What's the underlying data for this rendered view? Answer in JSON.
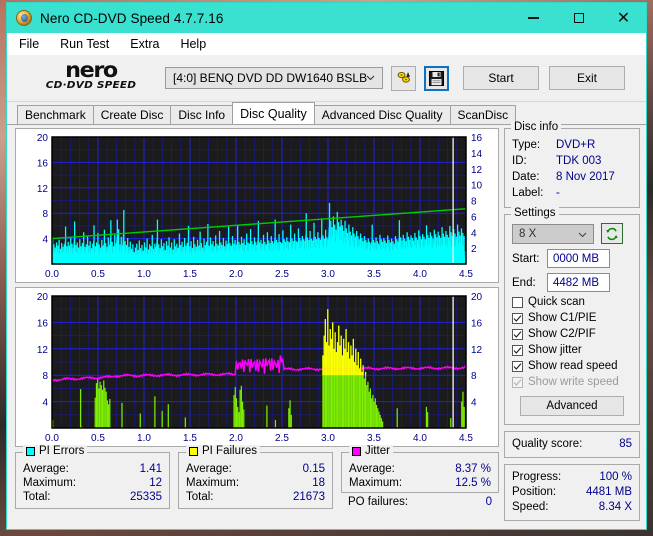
{
  "window": {
    "title": "Nero CD-DVD Speed 4.7.7.16",
    "icon": "nero-disc-icon",
    "accent_titlebar": "#3ae0d0",
    "minimize": "–",
    "maximize": "□",
    "close": "✕"
  },
  "menu": {
    "items": [
      "File",
      "Run Test",
      "Extra",
      "Help"
    ]
  },
  "toolbar": {
    "logo_main": "nero",
    "logo_sub": "CD·DVD  SPEED",
    "drive": "[4:0]   BENQ DVD DD DW1640 BSLB",
    "icon_buttons": [
      "disc-speed-icon",
      "save-floppy-icon"
    ],
    "start_label": "Start",
    "exit_label": "Exit"
  },
  "tabs": {
    "items": [
      "Benchmark",
      "Create Disc",
      "Disc Info",
      "Disc Quality",
      "Advanced Disc Quality",
      "ScanDisc"
    ],
    "active": "Disc Quality"
  },
  "disc_info": {
    "legend": "Disc info",
    "rows": [
      {
        "key": "Type:",
        "value": "DVD+R"
      },
      {
        "key": "ID:",
        "value": "TDK 003"
      },
      {
        "key": "Date:",
        "value": "8 Nov 2017"
      },
      {
        "key": "Label:",
        "value": "-"
      }
    ]
  },
  "settings": {
    "legend": "Settings",
    "speed": "8 X",
    "refresh_icon": "refresh-icon",
    "start_label": "Start:",
    "start_value": "0000 MB",
    "end_label": "End:",
    "end_value": "4482 MB",
    "checkboxes": [
      {
        "label": "Quick scan",
        "checked": false,
        "disabled": false
      },
      {
        "label": "Show C1/PIE",
        "checked": true,
        "disabled": false
      },
      {
        "label": "Show C2/PIF",
        "checked": true,
        "disabled": false
      },
      {
        "label": "Show jitter",
        "checked": true,
        "disabled": false
      },
      {
        "label": "Show read speed",
        "checked": true,
        "disabled": false
      },
      {
        "label": "Show write speed",
        "checked": true,
        "disabled": true
      }
    ],
    "advanced_label": "Advanced"
  },
  "quality": {
    "label": "Quality score:",
    "value": "85"
  },
  "progress": {
    "rows": [
      {
        "key": "Progress:",
        "value": "100 %"
      },
      {
        "key": "Position:",
        "value": "4481 MB"
      },
      {
        "key": "Speed:",
        "value": "8.34 X"
      }
    ]
  },
  "stats": {
    "pi_errors": {
      "title": "PI Errors",
      "color": "#00ffff",
      "rows": [
        {
          "key": "Average:",
          "value": "1.41"
        },
        {
          "key": "Maximum:",
          "value": "12"
        },
        {
          "key": "Total:",
          "value": "25335"
        }
      ]
    },
    "pi_failures": {
      "title": "PI Failures",
      "color": "#ffff00",
      "rows": [
        {
          "key": "Average:",
          "value": "0.15"
        },
        {
          "key": "Maximum:",
          "value": "18"
        },
        {
          "key": "Total:",
          "value": "21673"
        }
      ]
    },
    "jitter": {
      "title": "Jitter",
      "color": "#ff00ff",
      "rows": [
        {
          "key": "Average:",
          "value": "8.37 %"
        },
        {
          "key": "Maximum:",
          "value": "12.5 %"
        }
      ],
      "po_label": "PO failures:",
      "po_value": "0"
    }
  },
  "chart_data": [
    {
      "type": "area",
      "title": "PI Errors / Read speed",
      "xlabel": "",
      "ylabel": "PI Errors",
      "x_ticks": [
        "0.0",
        "0.5",
        "1.0",
        "1.5",
        "2.0",
        "2.5",
        "3.0",
        "3.5",
        "4.0",
        "4.5"
      ],
      "xlim": [
        0,
        4.5
      ],
      "y_left_ticks": [
        4,
        8,
        12,
        16,
        20
      ],
      "ylim": [
        0,
        20
      ],
      "y_right_ticks": [
        2,
        4,
        6,
        8,
        10,
        12,
        14,
        16
      ],
      "y_right_lim": [
        0,
        16
      ],
      "grid": true,
      "background": "#1b1b1b",
      "series": [
        {
          "name": "PI Errors",
          "color": "#00ffff",
          "kind": "area"
        },
        {
          "name": "Read speed",
          "color": "#00cc00",
          "kind": "line"
        }
      ],
      "pi_values": [
        4.2,
        3.1,
        2.6,
        3.4,
        2.9,
        3.8,
        2.4,
        3.3,
        2.7,
        3.1,
        5.9,
        2.8,
        3.5,
        2.9,
        4.1,
        3.2,
        2.5,
        6.7,
        3.0,
        3.4,
        2.6,
        3.9,
        2.8,
        3.3,
        5.0,
        2.7,
        3.1,
        4.4,
        2.9,
        3.6,
        2.5,
        3.2,
        6.1,
        2.8,
        3.4,
        4.9,
        3.1,
        2.6,
        3.8,
        2.9,
        5.4,
        3.3,
        2.7,
        4.2,
        3.0,
        6.9,
        3.5,
        2.8,
        4.6,
        3.2,
        7.0,
        5.5,
        3.1,
        4.3,
        2.9,
        8.5,
        3.6,
        3.0,
        4.1,
        2.7,
        3.5,
        2.4,
        3.1,
        1.9,
        2.6,
        3.2,
        2.2,
        3.7,
        2.5,
        3.0,
        2.1,
        3.4,
        2.6,
        4.0,
        2.3,
        3.1,
        2.8,
        4.6,
        2.4,
        3.2,
        2.7,
        7.0,
        3.1,
        2.5,
        3.9,
        2.8,
        3.3,
        2.2,
        3.6,
        2.9,
        4.2,
        2.6,
        3.4,
        2.3,
        3.9,
        2.8,
        3.2,
        2.5,
        4.8,
        3.0,
        3.5,
        2.7,
        4.1,
        2.9,
        3.3,
        6.0,
        2.8,
        3.6,
        2.5,
        4.3,
        3.1,
        2.7,
        3.8,
        2.9,
        5.1,
        3.3,
        2.6,
        4.0,
        3.0,
        3.5,
        6.3,
        2.9,
        4.2,
        3.1,
        3.6,
        2.8,
        4.5,
        3.2,
        2.9,
        5.2,
        3.4,
        3.0,
        4.1,
        2.8,
        3.7,
        3.1,
        5.9,
        3.3,
        2.9,
        4.4,
        3.2,
        3.8,
        3.0,
        6.0,
        3.5,
        3.1,
        4.3,
        3.3,
        3.9,
        3.0,
        4.8,
        3.4,
        3.2,
        5.5,
        3.6,
        3.1,
        4.2,
        3.5,
        3.0,
        6.8,
        3.4,
        3.8,
        3.2,
        4.6,
        3.5,
        3.1,
        5.0,
        3.7,
        3.3,
        4.4,
        3.6,
        3.2,
        7.0,
        3.8,
        3.4,
        4.7,
        3.5,
        3.3,
        5.3,
        3.9,
        3.5,
        4.2,
        3.6,
        3.4,
        6.2,
        4.0,
        3.6,
        4.8,
        3.7,
        3.5,
        5.6,
        4.1,
        3.7,
        4.4,
        3.9,
        3.6,
        8.0,
        4.2,
        3.8,
        5.2,
        4.0,
        3.7,
        6.5,
        4.3,
        3.9,
        5.0,
        4.1,
        3.8,
        7.2,
        4.5,
        4.0,
        5.4,
        4.2,
        3.9,
        9.6,
        6.8,
        5.8,
        7.5,
        6.2,
        5.4,
        8.2,
        6.6,
        5.9,
        7.0,
        6.1,
        5.2,
        6.8,
        5.6,
        4.9,
        6.2,
        5.1,
        4.5,
        5.8,
        4.8,
        4.3,
        5.2,
        4.4,
        3.9,
        4.8,
        4.1,
        3.6,
        4.4,
        3.8,
        3.4,
        4.0,
        3.5,
        3.2,
        6.2,
        3.8,
        3.4,
        4.2,
        3.6,
        3.2,
        4.6,
        3.9,
        3.5,
        4.1,
        3.7,
        3.3,
        4.5,
        3.8,
        3.4,
        4.0,
        3.6,
        3.2,
        4.4,
        3.9,
        3.5,
        6.9,
        4.2,
        3.7,
        4.6,
        4.0,
        3.6,
        5.0,
        4.3,
        3.8,
        4.5,
        4.1,
        3.7,
        4.9,
        4.2,
        3.8,
        5.3,
        4.4,
        3.9,
        4.7,
        4.3,
        3.9,
        6.1,
        4.6,
        4.1,
        5.0,
        4.4,
        4.0,
        5.4,
        4.7,
        4.2,
        5.1,
        4.5,
        4.1,
        5.8,
        4.8,
        4.3,
        5.2,
        4.6,
        4.2,
        6.0,
        5.0,
        4.4,
        5.5,
        4.8,
        4.3,
        6.2,
        5.1,
        4.5,
        5.6,
        4.9,
        4.4,
        2.0
      ]
    },
    {
      "type": "area",
      "title": "PI Failures / Jitter",
      "xlabel": "",
      "ylabel": "PI Failures",
      "x_ticks": [
        "0.0",
        "0.5",
        "1.0",
        "1.5",
        "2.0",
        "2.5",
        "3.0",
        "3.5",
        "4.0",
        "4.5"
      ],
      "xlim": [
        0,
        4.5
      ],
      "y_left_ticks": [
        4,
        8,
        12,
        16,
        20
      ],
      "ylim": [
        0,
        20
      ],
      "y_right_ticks": [
        4,
        8,
        12,
        16,
        20
      ],
      "y_right_lim": [
        0,
        20
      ],
      "grid": true,
      "background": "#1b1b1b",
      "series": [
        {
          "name": "PI Failures",
          "color": "#66ee00",
          "kind": "area"
        },
        {
          "name": "Jitter",
          "color": "#ff00ff",
          "kind": "line"
        }
      ],
      "pif_values": [
        1.2,
        0,
        0,
        0,
        0,
        0,
        0,
        0,
        0,
        0,
        0,
        0,
        0,
        0,
        0,
        0,
        0,
        0,
        0,
        0,
        0,
        0,
        0,
        5.9,
        0.2,
        0,
        0,
        0,
        0,
        0,
        0,
        0,
        0,
        0,
        0,
        4.6,
        6.8,
        7.4,
        6.0,
        7.0,
        6.5,
        5.8,
        7.2,
        6.1,
        5.5,
        4.2,
        3.6,
        4.4,
        0,
        0,
        0,
        0,
        0,
        0,
        0,
        0,
        0,
        3.8,
        0,
        0,
        0,
        0,
        0,
        0,
        0,
        0,
        0,
        0,
        0,
        0,
        0,
        0,
        2.2,
        0,
        0,
        0,
        0,
        0,
        0,
        0,
        0,
        0,
        0,
        0,
        4.8,
        0,
        0,
        0,
        0,
        0,
        2.6,
        0,
        0,
        0,
        0,
        3.6,
        0,
        0,
        0,
        0,
        0,
        0,
        0,
        0,
        0,
        0,
        0,
        0,
        0,
        1.6,
        0,
        0,
        0,
        0,
        0,
        0,
        0,
        0,
        0,
        0,
        0,
        0,
        0,
        0,
        0,
        0,
        0,
        0,
        0,
        0,
        0,
        0,
        0,
        0,
        0,
        0,
        0,
        0,
        0,
        0,
        0,
        0,
        0,
        0,
        0,
        0,
        0,
        0,
        0,
        5.0,
        6.2,
        4.5,
        3.2,
        2.4,
        5.8,
        6.4,
        4.0,
        2.8,
        0,
        0,
        0,
        0,
        0,
        0,
        0,
        0,
        0,
        0,
        0,
        0,
        0,
        0,
        0,
        0,
        0,
        0,
        3.4,
        0,
        0,
        0,
        0,
        0,
        0,
        1.2,
        0,
        0,
        0,
        0,
        0,
        0,
        0,
        0,
        0,
        0,
        3.0,
        4.2,
        2.0,
        0,
        0,
        0,
        0,
        0,
        0,
        0,
        0,
        0,
        0,
        0,
        0,
        0,
        0,
        0,
        0,
        0,
        0,
        0,
        0,
        0,
        0,
        0,
        0,
        0,
        11.0,
        14.0,
        16.5,
        13.0,
        18.0,
        12.5,
        15.0,
        13.5,
        16.0,
        12.0,
        14.5,
        11.5,
        13.0,
        15.5,
        12.5,
        14.0,
        11.0,
        13.5,
        12.0,
        15.0,
        11.5,
        13.0,
        10.5,
        12.5,
        11.0,
        13.5,
        10.0,
        12.0,
        9.5,
        11.5,
        9.0,
        10.5,
        8.5,
        9.5,
        7.5,
        8.5,
        6.5,
        7.0,
        5.5,
        6.0,
        4.5,
        5.0,
        4.0,
        4.5,
        3.5,
        3.0,
        2.5,
        2.0,
        1.5,
        1.0,
        0,
        0,
        0,
        0,
        0,
        0,
        0,
        0,
        0,
        0,
        0,
        3.0,
        0,
        0,
        0,
        0,
        0,
        0,
        0,
        0,
        0,
        0,
        0,
        0,
        0,
        0,
        0,
        0,
        0,
        0,
        0,
        0,
        0,
        0,
        0,
        3.2,
        2.4,
        0,
        0,
        0,
        0,
        0,
        0,
        0,
        0,
        0,
        0,
        0,
        0,
        0,
        0,
        0,
        0,
        0,
        0,
        1.5,
        0,
        0,
        0,
        0,
        0,
        0,
        0,
        0,
        4.0,
        5.5,
        3.2,
        0
      ]
    }
  ]
}
